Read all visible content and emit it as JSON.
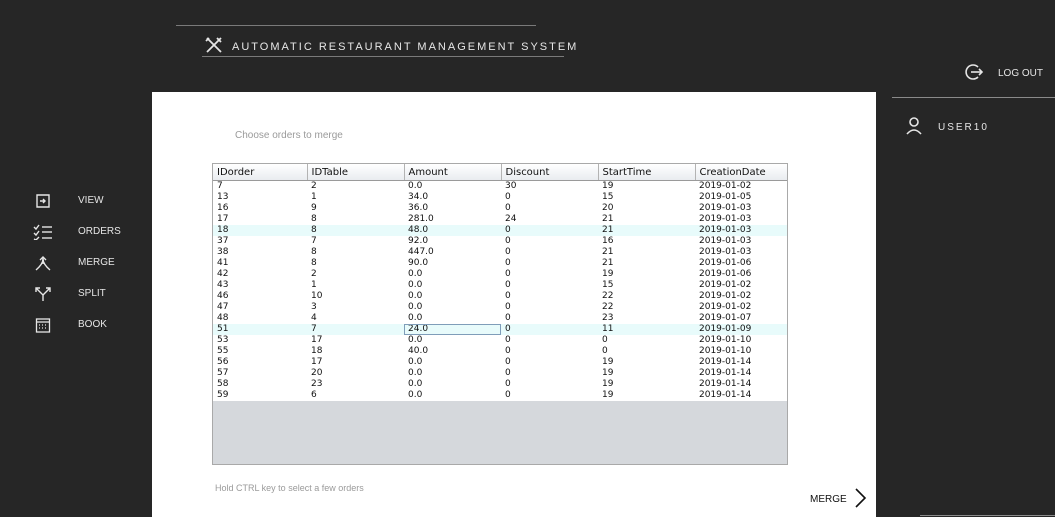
{
  "app": {
    "title": "AUTOMATIC RESTAURANT MANAGEMENT SYSTEM"
  },
  "header": {
    "logout_label": "LOG OUT",
    "user_label": "USER10"
  },
  "nav": {
    "items": [
      {
        "label": "VIEW",
        "icon": "view-icon"
      },
      {
        "label": "ORDERS",
        "icon": "list-check-icon"
      },
      {
        "label": "MERGE",
        "icon": "merge-icon"
      },
      {
        "label": "SPLIT",
        "icon": "split-icon"
      },
      {
        "label": "BOOK",
        "icon": "calendar-icon"
      }
    ]
  },
  "main": {
    "instruction": "Choose orders to merge",
    "hint": "Hold CTRL key to select a few orders",
    "merge_label": "MERGE"
  },
  "table": {
    "columns": [
      "IDorder",
      "IDTable",
      "Amount",
      "Discount",
      "StartTime",
      "CreationDate"
    ],
    "rows": [
      [
        "7",
        "2",
        "0.0",
        "30",
        "19",
        "2019-01-02"
      ],
      [
        "13",
        "1",
        "34.0",
        "0",
        "15",
        "2019-01-05"
      ],
      [
        "16",
        "9",
        "36.0",
        "0",
        "20",
        "2019-01-03"
      ],
      [
        "17",
        "8",
        "281.0",
        "24",
        "21",
        "2019-01-03"
      ],
      [
        "18",
        "8",
        "48.0",
        "0",
        "21",
        "2019-01-03"
      ],
      [
        "37",
        "7",
        "92.0",
        "0",
        "16",
        "2019-01-03"
      ],
      [
        "38",
        "8",
        "447.0",
        "0",
        "21",
        "2019-01-03"
      ],
      [
        "41",
        "8",
        "90.0",
        "0",
        "21",
        "2019-01-06"
      ],
      [
        "42",
        "2",
        "0.0",
        "0",
        "19",
        "2019-01-06"
      ],
      [
        "43",
        "1",
        "0.0",
        "0",
        "15",
        "2019-01-02"
      ],
      [
        "46",
        "10",
        "0.0",
        "0",
        "22",
        "2019-01-02"
      ],
      [
        "47",
        "3",
        "0.0",
        "0",
        "22",
        "2019-01-02"
      ],
      [
        "48",
        "4",
        "0.0",
        "0",
        "23",
        "2019-01-07"
      ],
      [
        "51",
        "7",
        "24.0",
        "0",
        "11",
        "2019-01-09"
      ],
      [
        "53",
        "17",
        "0.0",
        "0",
        "0",
        "2019-01-10"
      ],
      [
        "55",
        "18",
        "40.0",
        "0",
        "0",
        "2019-01-10"
      ],
      [
        "56",
        "17",
        "0.0",
        "0",
        "19",
        "2019-01-14"
      ],
      [
        "57",
        "20",
        "0.0",
        "0",
        "19",
        "2019-01-14"
      ],
      [
        "58",
        "23",
        "0.0",
        "0",
        "19",
        "2019-01-14"
      ],
      [
        "59",
        "6",
        "0.0",
        "0",
        "19",
        "2019-01-14"
      ]
    ]
  },
  "colors": {
    "background": "#262626",
    "panel": "#ffffff",
    "row_highlight": "#e8fbfb"
  }
}
